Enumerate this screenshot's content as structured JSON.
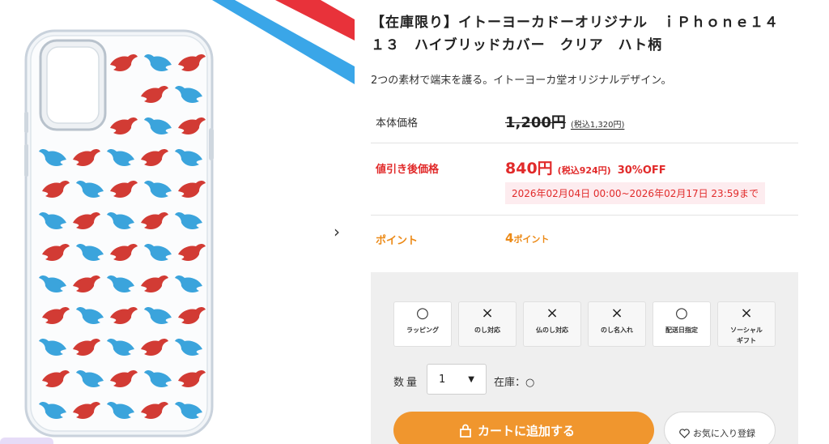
{
  "nav": {
    "next_glyph": "›"
  },
  "product": {
    "title": "【在庫限り】イトーヨーカドーオリジナル　ｉＰｈｏｎｅ１４　１３　ハイブリッドカバー　クリア　ハト柄",
    "lead": "2つの素材で端末を護る。イトーヨーカ堂オリジナルデザイン。"
  },
  "price": {
    "base_label": "本体価格",
    "base_price": "1,200円",
    "base_tax": "(税込1,320円)",
    "sale_label": "値引き後価格",
    "sale_price": "840円",
    "sale_tax": "(税込924円)",
    "sale_off": "30%OFF",
    "sale_period": "2026年02月04日 00:00~2026年02月17日 23:59まで",
    "sale_color": "#e12a2a"
  },
  "point": {
    "label": "ポイント",
    "value": "4",
    "unit": "ポイント",
    "color": "#ec8a17"
  },
  "options": [
    {
      "mark": "○",
      "label": "ラッピング",
      "available": true
    },
    {
      "mark": "×",
      "label": "のし対応",
      "available": false
    },
    {
      "mark": "×",
      "label": "仏のし対応",
      "available": false
    },
    {
      "mark": "×",
      "label": "のし名入れ",
      "available": false
    },
    {
      "mark": "○",
      "label": "配送日指定",
      "available": true
    },
    {
      "mark": "×",
      "label": "ソーシャル\nギフト",
      "available": false
    }
  ],
  "purchase": {
    "qty_label": "数量",
    "qty_value": "1",
    "stock_label": "在庫：○",
    "cart_label": "カートに追加する",
    "fav_label": "お気に入り登録",
    "cart_color": "#f0962e"
  },
  "icons": {
    "cart": "bag-icon",
    "fav": "heart-icon",
    "select": "caret-down-icon"
  }
}
